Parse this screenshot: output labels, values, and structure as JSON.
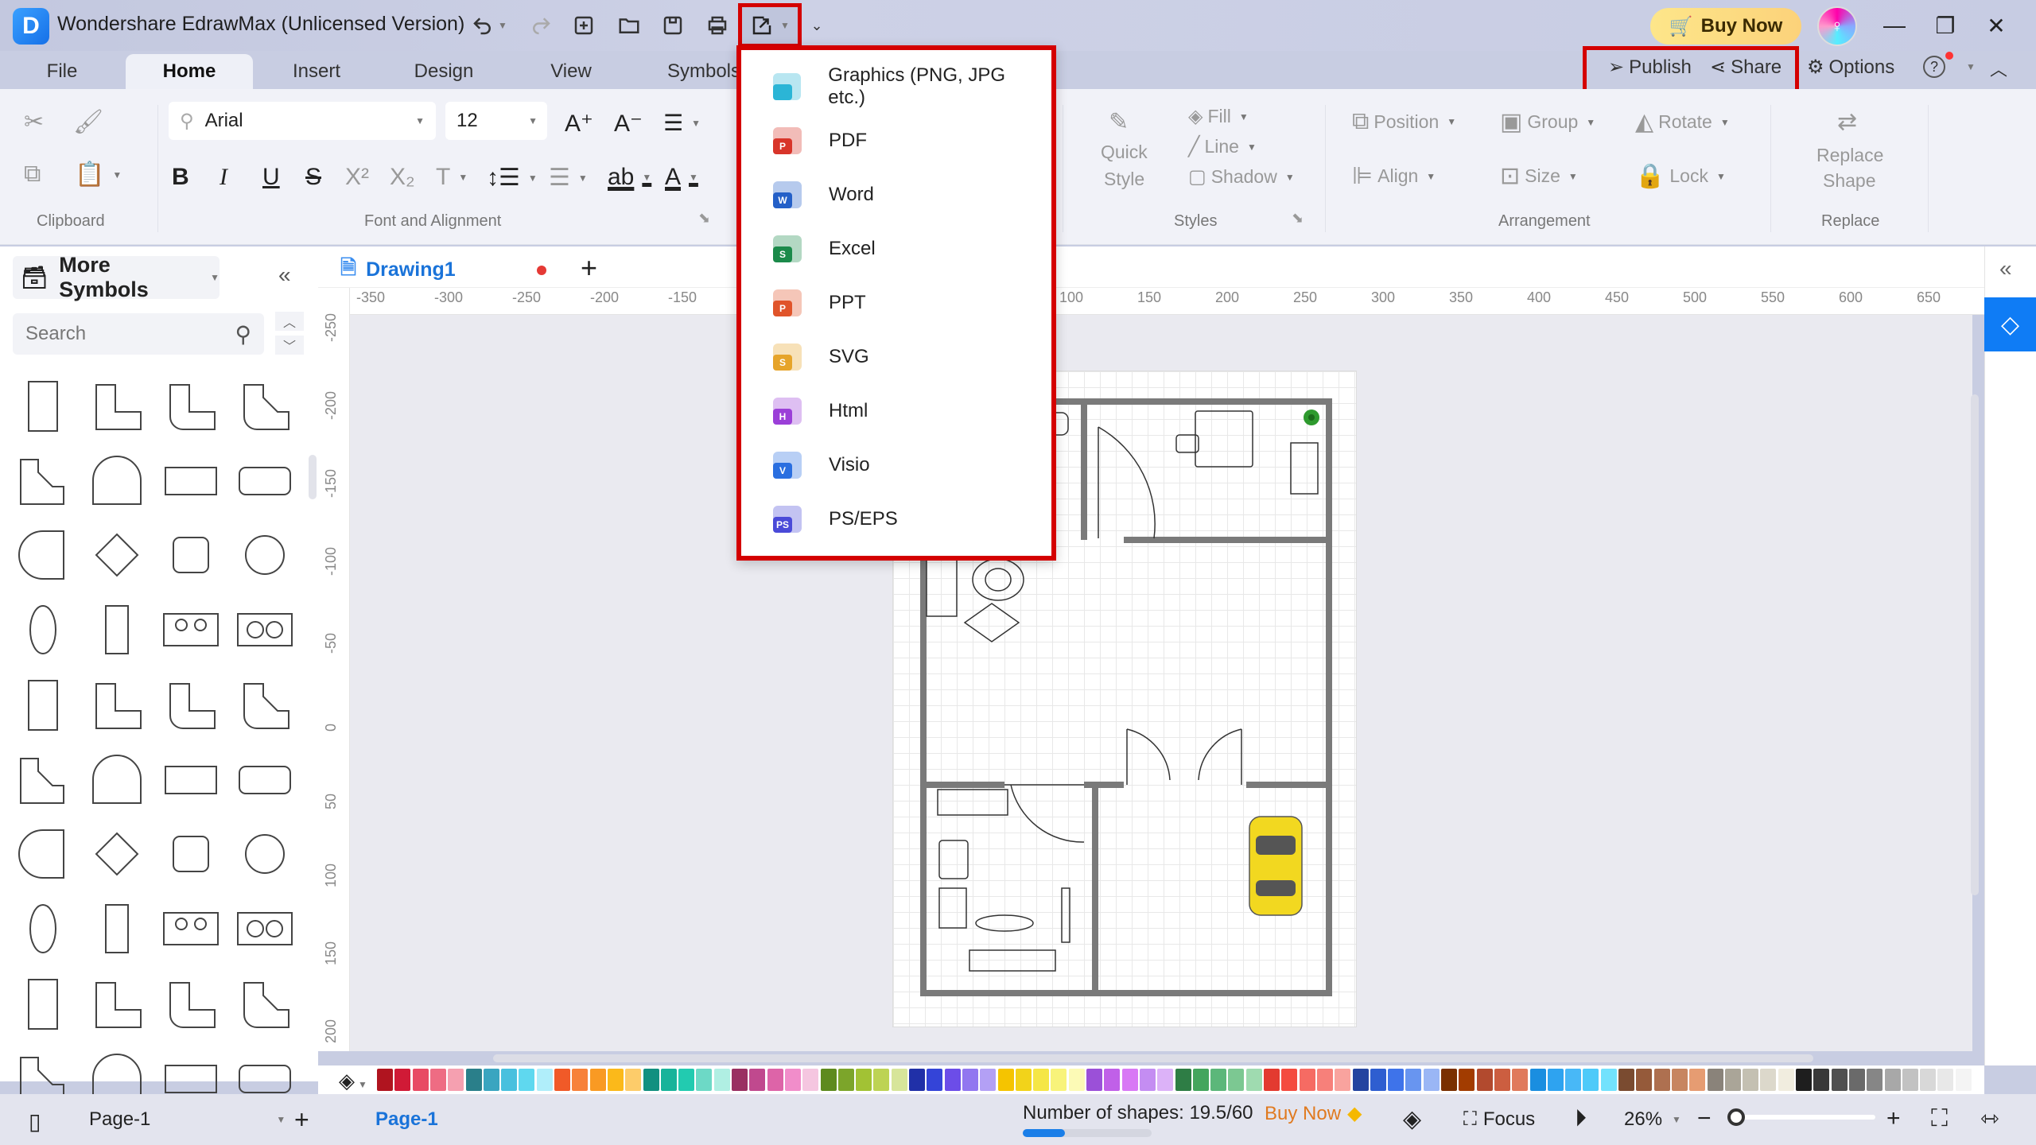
{
  "app": {
    "title": "Wondershare EdrawMax (Unlicensed Version)",
    "logo_letter": "D",
    "buy_now": "Buy Now"
  },
  "quick_access": [
    "undo-icon",
    "redo-icon",
    "new-icon",
    "open-icon",
    "save-icon",
    "print-icon",
    "export-icon",
    "customize-icon"
  ],
  "menu_tabs": [
    "File",
    "Home",
    "Insert",
    "Design",
    "View",
    "Symbols"
  ],
  "active_tab": "Home",
  "top_right": {
    "publish": "Publish",
    "share": "Share",
    "options": "Options",
    "help": "?"
  },
  "ribbon": {
    "font_name": "Arial",
    "font_size": "12",
    "groups": {
      "clipboard": "Clipboard",
      "font": "Font and Alignment",
      "styles": "Styles",
      "arrangement": "Arrangement",
      "replace": "Replace"
    },
    "styles": {
      "quick_style_1": "Quick",
      "quick_style_2": "Style",
      "fill": "Fill",
      "line": "Line",
      "shadow": "Shadow"
    },
    "arrangement": {
      "position": "Position",
      "group": "Group",
      "rotate": "Rotate",
      "align": "Align",
      "size": "Size",
      "lock": "Lock"
    },
    "replace": {
      "label_1": "Replace",
      "label_2": "Shape"
    }
  },
  "export_menu": {
    "items": [
      {
        "label": "Graphics (PNG, JPG etc.)",
        "letter": "",
        "color": "#2bb5d6"
      },
      {
        "label": "PDF",
        "letter": "P",
        "color": "#d8352a"
      },
      {
        "label": "Word",
        "letter": "W",
        "color": "#2460c8"
      },
      {
        "label": "Excel",
        "letter": "S",
        "color": "#1b8a4a"
      },
      {
        "label": "PPT",
        "letter": "P",
        "color": "#e0542a"
      },
      {
        "label": "SVG",
        "letter": "S",
        "color": "#e6a42a"
      },
      {
        "label": "Html",
        "letter": "H",
        "color": "#9b3fd8"
      },
      {
        "label": "Visio",
        "letter": "V",
        "color": "#2a6fe0"
      },
      {
        "label": "PS/EPS",
        "letter": "PS",
        "color": "#4a4ad8"
      }
    ]
  },
  "left_panel": {
    "title": "More Symbols",
    "search_placeholder": "Search"
  },
  "document": {
    "tab_name": "Drawing1",
    "unsaved_dot": true
  },
  "rulers": {
    "horizontal": [
      "-350",
      "-300",
      "-250",
      "-200",
      "-150",
      "100",
      "150",
      "200",
      "250",
      "300",
      "350",
      "400",
      "450",
      "500",
      "550",
      "600",
      "650"
    ],
    "vertical": [
      "-250",
      "-200",
      "-150",
      "-100",
      "-50",
      "0",
      "50",
      "100",
      "150",
      "200"
    ]
  },
  "palette": [
    "#b0141f",
    "#d01a36",
    "#e84a64",
    "#ee6c83",
    "#f5a0b0",
    "#2a7f8a",
    "#3aa5c0",
    "#48c0de",
    "#5fd8ef",
    "#b0eefa",
    "#f05a28",
    "#f7813a",
    "#f99a23",
    "#fbb91a",
    "#fdcc6a",
    "#129080",
    "#18b39a",
    "#22cbb0",
    "#6dd9c6",
    "#b0efe3",
    "#9a2f62",
    "#c0498e",
    "#dd64a8",
    "#f18dca",
    "#f5c6e0",
    "#5e8a1e",
    "#7ca52a",
    "#a2c234",
    "#bdd354",
    "#d7e59a",
    "#2030a8",
    "#3444d8",
    "#6c4de8",
    "#9176f0",
    "#b3a0f5",
    "#f5c400",
    "#f2d31a",
    "#f5e646",
    "#f8f37a",
    "#fcfab6",
    "#9b50d8",
    "#c060e8",
    "#d878f5",
    "#c48df2",
    "#dcb2f8",
    "#2e7d45",
    "#44a55d",
    "#5cb77a",
    "#7cc892",
    "#9fdbb0",
    "#e33a30",
    "#f44b3f",
    "#f66b63",
    "#f7807a",
    "#f9a39e",
    "#2444a0",
    "#2e5ed0",
    "#3e73ea",
    "#6895f0",
    "#9ab6f5",
    "#7a3000",
    "#a23c00",
    "#b24a2e",
    "#cc5e40",
    "#e07a5c",
    "#1a8ee0",
    "#2ea3f0",
    "#48b8f7",
    "#4ecaf9",
    "#72e2fd",
    "#7a4b30",
    "#955a3a",
    "#ae7050",
    "#c78560",
    "#e69c72",
    "#8a837a",
    "#aaa598",
    "#c4c0b2",
    "#dcd8cb",
    "#f1eddf",
    "#1e1e1e",
    "#383838",
    "#505050",
    "#6a6a6a",
    "#868686",
    "#a8a8a8",
    "#c2c2c2",
    "#d8d8d8",
    "#e8e8e8",
    "#f4f4f4"
  ],
  "status": {
    "page_selector": "Page-1",
    "page_tab": "Page-1",
    "shape_count_label": "Number of shapes: 19.5/60",
    "shape_count_fraction": 0.325,
    "buy_now": "Buy Now",
    "focus": "Focus",
    "zoom": "26%"
  }
}
